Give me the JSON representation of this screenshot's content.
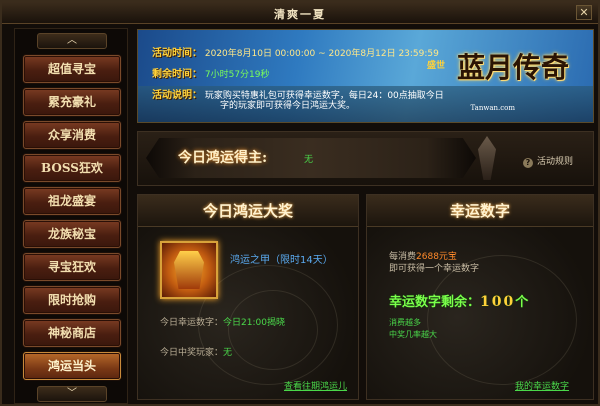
{
  "window": {
    "title": "清爽一夏",
    "close_glyph": "✕"
  },
  "sidebar": {
    "up_glyph": "︿",
    "down_glyph": "﹀",
    "items": [
      {
        "label": "超值寻宝"
      },
      {
        "label": "累充豪礼"
      },
      {
        "label": "众享消费"
      },
      {
        "label": "BOSS狂欢"
      },
      {
        "label": "祖龙盛宴"
      },
      {
        "label": "龙族秘宝"
      },
      {
        "label": "寻宝狂欢"
      },
      {
        "label": "限时抢购"
      },
      {
        "label": "神秘商店"
      },
      {
        "label": "鸿运当头"
      }
    ]
  },
  "banner": {
    "time_label": "活动时间：",
    "time_value": "2020年8月10日 00:00:00 ~ 2020年8月12日 23:59:59",
    "remain_label": "剩余时间：",
    "remain_value": "7小时57分19秒",
    "desc_label": "活动说明：",
    "desc_line1": "玩家购买特惠礼包可获得幸运数字，每日24：00点抽取今日",
    "desc_line2": "字的玩家即可获得今日鸿运大奖。",
    "logo_tag": "盛世",
    "logo_name": "蓝月传奇",
    "logo_sub": "Tanwan.com"
  },
  "winner": {
    "label": "今日鸿运得主:",
    "value": "无",
    "rules_icon": "?",
    "rules_label": "活动规则"
  },
  "prize_panel": {
    "title": "今日鸿运大奖",
    "item_name": "鸿运之甲（限时14天）",
    "lucky_label": "今日幸运数字：",
    "lucky_value": "今日21:00揭晓",
    "winner_label": "今日中奖玩家：",
    "winner_value": "无",
    "history_link": "查看往期鸿运儿"
  },
  "lucky_panel": {
    "title": "幸运数字",
    "line1_prefix": "每消费",
    "line1_amount": "2688元宝",
    "line2": "即可获得一个幸运数字",
    "remain_label": "幸运数字剩余：",
    "remain_value": "100",
    "remain_unit": "个",
    "tip1": "消费越多",
    "tip2": "中奖几率越大",
    "my_link": "我的幸运数字"
  }
}
